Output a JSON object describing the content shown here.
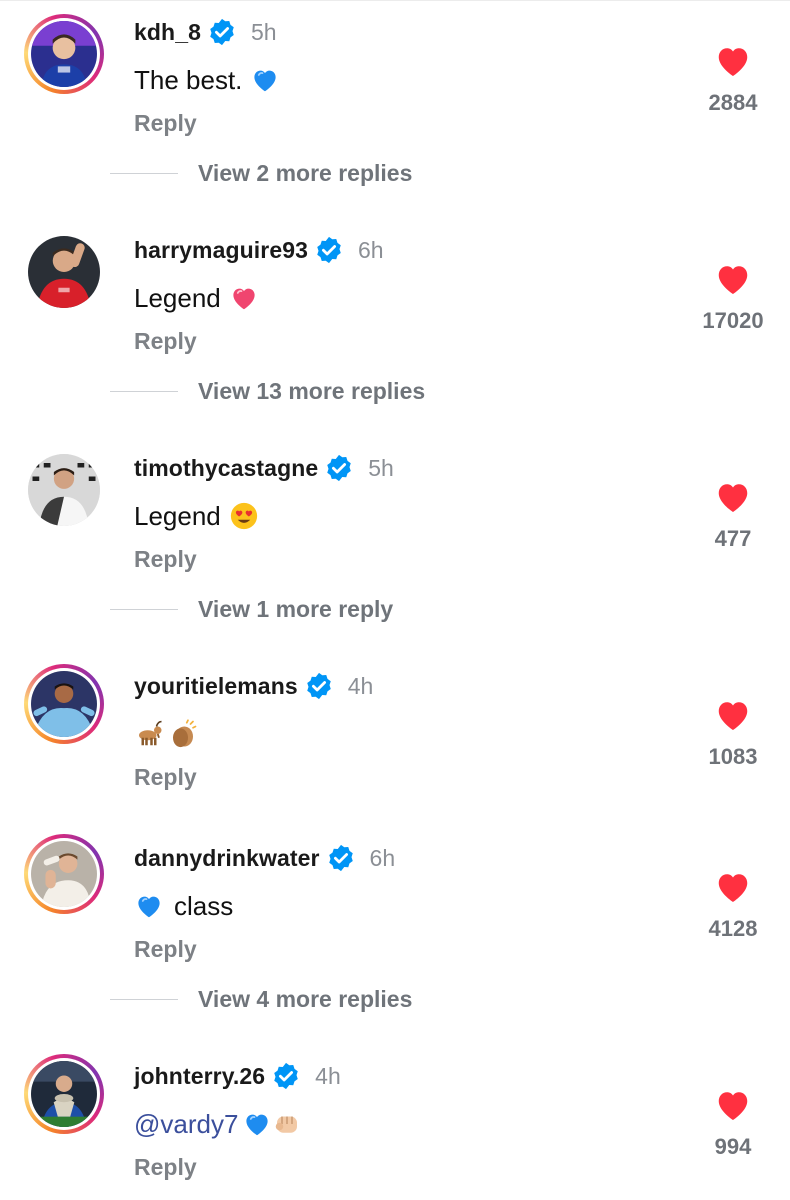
{
  "comments": [
    {
      "username": "kdh_8",
      "time": "5h",
      "text": "The best.",
      "mention": "",
      "emojis": [
        "blue-heart"
      ],
      "reply_label": "Reply",
      "likes": "2884",
      "view_more": "View 2 more replies",
      "story_ring": true
    },
    {
      "username": "harrymaguire93",
      "time": "6h",
      "text": "Legend",
      "mention": "",
      "emojis": [
        "pink-heart"
      ],
      "reply_label": "Reply",
      "likes": "17020",
      "view_more": "View 13 more replies",
      "story_ring": false
    },
    {
      "username": "timothycastagne",
      "time": "5h",
      "text": "Legend",
      "mention": "",
      "emojis": [
        "heart-eyes"
      ],
      "reply_label": "Reply",
      "likes": "477",
      "view_more": "View 1 more reply",
      "story_ring": false
    },
    {
      "username": "youritielemans",
      "time": "4h",
      "text": "",
      "mention": "",
      "emojis": [
        "goat",
        "clapping-hands"
      ],
      "reply_label": "Reply",
      "likes": "1083",
      "view_more": "",
      "story_ring": true
    },
    {
      "username": "dannydrinkwater",
      "time": "6h",
      "text": "class",
      "mention": "",
      "emojis": [
        "blue-heart"
      ],
      "reply_label": "Reply",
      "likes": "4128",
      "view_more": "View 4 more replies",
      "story_ring": true
    },
    {
      "username": "johnterry.26",
      "time": "4h",
      "text": "",
      "mention": "@vardy7",
      "emojis": [
        "blue-heart",
        "fist-bump"
      ],
      "reply_label": "Reply",
      "likes": "994",
      "view_more": "",
      "story_ring": true
    }
  ],
  "colors": {
    "like_red": "#ff3040",
    "verified_blue": "#0095f6",
    "mention_blue": "#3b4f9c",
    "muted_text": "#7d8186"
  },
  "icons": {
    "like": "heart-icon",
    "verified": "verified-badge-icon"
  }
}
